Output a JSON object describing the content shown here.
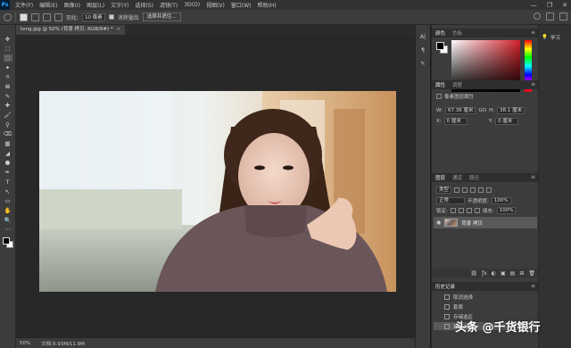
{
  "menubar": {
    "logo": "Ps",
    "items": [
      "文件(F)",
      "编辑(E)",
      "图像(I)",
      "图层(L)",
      "文字(Y)",
      "选择(S)",
      "滤镜(T)",
      "3D(D)",
      "视图(V)",
      "窗口(W)",
      "帮助(H)"
    ],
    "window_controls": [
      "—",
      "❐",
      "✕"
    ]
  },
  "options": {
    "feather_label": "羽化:",
    "feather_value": "10 像素",
    "antialias_label": "消除锯齿",
    "select_mask_button": "选择并遮住..."
  },
  "document": {
    "tab_title": "tong.jpg @ 50% (背景 拷贝, RGB/8#) *",
    "close": "×"
  },
  "status": {
    "zoom": "50%",
    "doc_size": "文档:5.93M/11.9M"
  },
  "toolbar": {
    "tools": [
      "✥",
      "⬚",
      "◌",
      "✦",
      "⌗",
      "⊠",
      "✎",
      "✚",
      "🖌",
      "⚲",
      "⌫",
      "▦",
      "◢",
      "●",
      "✒",
      "T",
      "↖",
      "▭",
      "✋",
      "🔍",
      "⋯"
    ]
  },
  "color_panel": {
    "tabs": [
      "颜色",
      "色板"
    ],
    "fg_color": "#000000",
    "bg_color": "#ffffff",
    "field_hue": "#d3202a"
  },
  "properties_panel": {
    "tabs": [
      "属性",
      "调整"
    ],
    "subtitle": "像素图层属性",
    "w_label": "W:",
    "w_value": "67.36 厘米",
    "go_label": "GO",
    "h_label": "H:",
    "h_value": "38.1 厘米",
    "x_label": "X:",
    "x_value": "0 厘米",
    "y_label": "Y:",
    "y_value": "0 厘米"
  },
  "layers_panel": {
    "tabs": [
      "图层",
      "通道",
      "路径"
    ],
    "filter_label": "类型",
    "blend_mode": "正常",
    "opacity_label": "不透明度:",
    "opacity_value": "100%",
    "lock_label": "锁定:",
    "fill_label": "填充:",
    "fill_value": "100%",
    "layer_name": "背景 拷贝",
    "footer_icons": [
      "ƒx",
      "◐",
      "▣",
      "▤",
      "⊞",
      "🗑"
    ]
  },
  "history_panel": {
    "title": "历史记录",
    "items": [
      "取消选择",
      "套索",
      "存储选区",
      "载入选区"
    ]
  },
  "learn_panel": {
    "label": "学习"
  },
  "watermark": "头条 @千货银行"
}
